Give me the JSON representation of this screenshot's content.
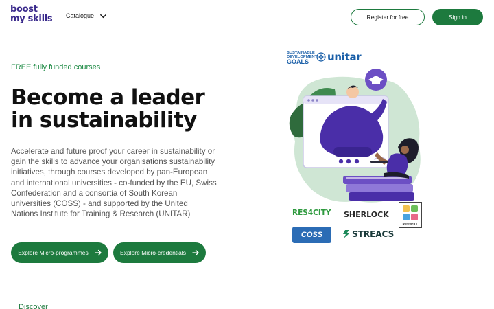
{
  "logo": {
    "line1": "boost",
    "line2": "my skills"
  },
  "nav": {
    "catalogue_label": "Catalogue"
  },
  "header_buttons": {
    "register": "Register for free",
    "signin": "Sign in"
  },
  "hero": {
    "eyebrow": "FREE fully funded courses",
    "title_line1": "Become a leader",
    "title_line2": "in sustainability",
    "description": "Accelerate and future proof your career in sustainability or gain the skills to advance your organisations sustainability initiatives, through courses developed by pan-European and international universities - co-funded by the EU, Swiss Confederation and a consortia of South Korean universities (COSS) - and supported by the United Nations Institute for Training & Research (UNITAR)",
    "cta_primary": "Explore Micro-programmes",
    "cta_secondary": "Explore Micro-credentials"
  },
  "next_section": {
    "label": "Discover"
  },
  "partners": {
    "sdg_line1": "SUSTAINABLE",
    "sdg_line2": "DEVELOPMENT",
    "sdg_line3": "GOALS",
    "unitar": "unitar",
    "res4city": "RES4CITY",
    "sherlock": "SHERLOCK",
    "resskill": "RESSKILL",
    "coss": "COSS",
    "streacs": "STREACS"
  },
  "colors": {
    "brand_green": "#1d7a3e",
    "eyebrow_green": "#1d8a44",
    "logo_purple": "#3a2a8c",
    "illustration_purple": "#4a2ea8",
    "blob_green": "#cfe6d4"
  },
  "icons": {
    "catalogue_toggle": "chevron-down-icon",
    "cta_arrow": "arrow-right-icon",
    "unitar_emblem": "un-emblem-icon",
    "grad_cap": "graduation-cap-icon",
    "wifi": "wifi-icon"
  }
}
